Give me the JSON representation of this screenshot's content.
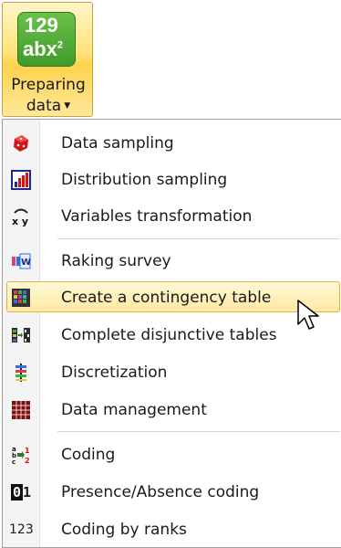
{
  "ribbon": {
    "button_label_line1": "Preparing",
    "button_label_line2": "data",
    "icon_text_top": "129",
    "icon_text_bottom": "abx"
  },
  "menu": {
    "groups": [
      {
        "items": [
          {
            "label": "Data sampling",
            "icon": "dice-icon"
          },
          {
            "label": "Distribution sampling",
            "icon": "bar-chart-icon"
          },
          {
            "label": "Variables transformation",
            "icon": "transform-xy-icon"
          }
        ]
      },
      {
        "items": [
          {
            "label": "Raking survey",
            "icon": "weight-icon"
          },
          {
            "label": "Create a contingency table",
            "icon": "grid-table-icon",
            "highlighted": true
          },
          {
            "label": "Complete disjunctive tables",
            "icon": "disjunctive-table-icon"
          },
          {
            "label": "Discretization",
            "icon": "discretization-icon"
          },
          {
            "label": "Data management",
            "icon": "data-management-icon"
          }
        ]
      },
      {
        "items": [
          {
            "label": "Coding",
            "icon": "coding-icon"
          },
          {
            "label": "Presence/Absence coding",
            "icon": "presence-absence-icon",
            "icon_text": "01"
          },
          {
            "label": "Coding by ranks",
            "icon": "ranks-icon",
            "icon_text": "123"
          }
        ]
      }
    ]
  },
  "colors": {
    "highlight_border": "#e3b13c",
    "highlight_fill": "#ffeaa3",
    "ribbon_active": "#ffd24d",
    "icon_green": "#4caf35"
  }
}
